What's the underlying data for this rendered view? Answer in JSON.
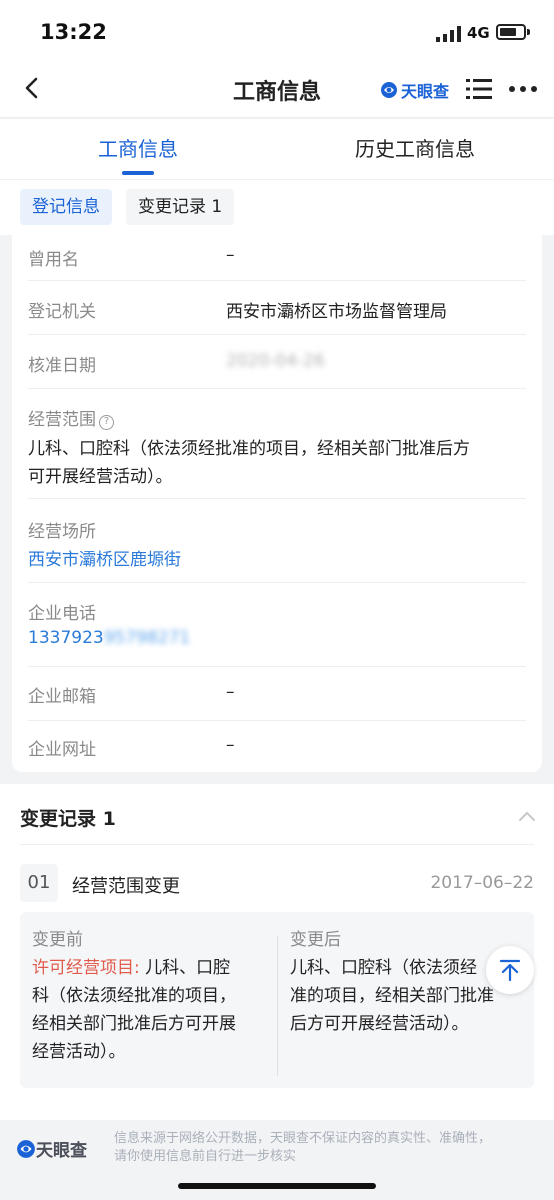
{
  "status_bar": {
    "time": "13:22",
    "network": "4G"
  },
  "nav": {
    "title": "工商信息",
    "brand": "天眼查",
    "back_icon": "chevron-left-icon",
    "menu_icon": "list-icon",
    "more_icon": "more-dots-icon"
  },
  "tabs": [
    {
      "label": "工商信息",
      "active": true
    },
    {
      "label": "历史工商信息",
      "active": false
    }
  ],
  "subtabs": [
    {
      "label": "登记信息",
      "active": true
    },
    {
      "label": "变更记录 1",
      "active": false
    }
  ],
  "info": {
    "former_name": {
      "label": "曾用名",
      "value": "–"
    },
    "authority": {
      "label": "登记机关",
      "value": "西安市灞桥区市场监督管理局"
    },
    "approval_date": {
      "label": "核准日期",
      "value": "2020-04-26"
    },
    "scope": {
      "label": "经营范围",
      "value_line1": "儿科、口腔科（依法须经批准的项目，经相关部门批准后方",
      "value_line2": "可开展经营活动）。"
    },
    "address": {
      "label": "经营场所",
      "value": "西安市灞桥区鹿塬街"
    },
    "phone": {
      "label": "企业电话",
      "value_visible": "1337923",
      "value_hidden": "95798271"
    },
    "email": {
      "label": "企业邮箱",
      "value": "–"
    },
    "website": {
      "label": "企业网址",
      "value": "–"
    }
  },
  "changes": {
    "title": "变更记录 1",
    "records": [
      {
        "index": "01",
        "type": "经营范围变更",
        "date": "2017–06–22",
        "before_label": "变更前",
        "before_highlight": "许可经营项目:",
        "before_line1": " 儿科、口腔",
        "before_line2": "科（依法须经批准的项目，",
        "before_line3": "经相关部门批准后方可开展",
        "before_line4": "经营活动）。",
        "after_label": "变更后",
        "after_line1": "儿科、口腔科（依法须经",
        "after_line2": "准的项目，经相关部门批准",
        "after_line3": "后方可开展经营活动）。"
      }
    ]
  },
  "footer": {
    "brand": "天眼查",
    "line1": "信息来源于网络公开数据，天眼查不保证内容的真实性、准确性，",
    "line2": "请你使用信息前自行进一步核实"
  },
  "colors": {
    "brand_blue": "#1a62d6",
    "link_blue": "#2a7ad9",
    "highlight_red": "#e05c4c"
  }
}
